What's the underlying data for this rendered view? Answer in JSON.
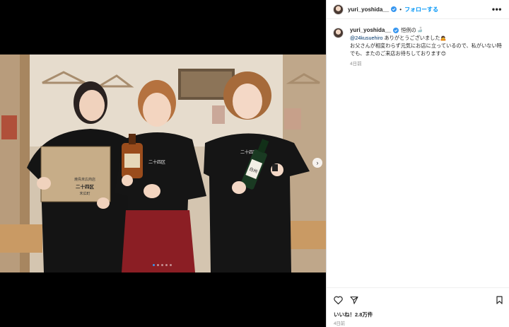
{
  "post": {
    "username": "yuri_yoshida__",
    "follow_label": "フォローする",
    "separator": "•",
    "more_label": "•••",
    "caption_line1": "恒例の",
    "caption_mention": "@24kusuehiro",
    "caption_line2": "ありがとうございました",
    "caption_line3": "お父さんが相変わらず元気にお店に立っているので、私がいない時でも、またのご来店お待ちしております",
    "caption_time": "4日前",
    "likes_label": "いいね！2.8万件",
    "date_label": "4日前"
  },
  "photo": {
    "shirt_text": "二十四区",
    "box_text_top": "焼鳥末広商店",
    "box_text_main": "二十四区",
    "box_text_bottom": "末広町",
    "bottle_label": "白州",
    "carousel_count": 5,
    "carousel_active": 1
  },
  "colors": {
    "accent_blue": "#0095f6",
    "verified_blue": "#3897f0",
    "text": "#262626",
    "muted": "#8e8e8e"
  },
  "icons": {
    "like": "heart-icon",
    "share": "send-icon",
    "save": "bookmark-icon",
    "verified": "verified-badge-icon",
    "next": "chevron-right-icon"
  }
}
